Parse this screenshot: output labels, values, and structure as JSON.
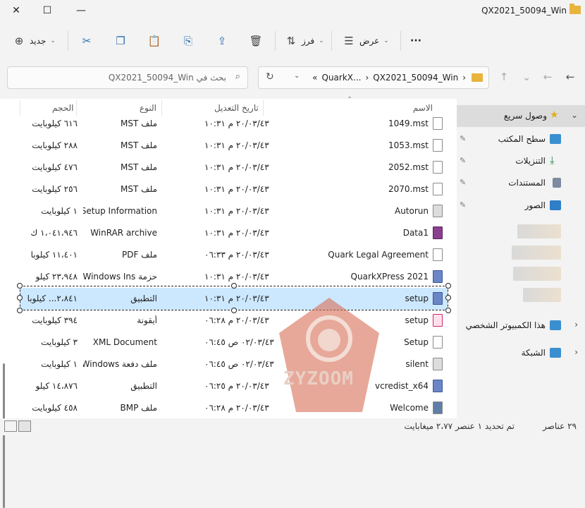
{
  "window": {
    "title": "QX2021_50094_Win",
    "close_glyph": "✕",
    "maximize_glyph": "☐",
    "minimize_glyph": "—"
  },
  "toolbar": {
    "new_label": "جديد",
    "sort_label": "فرز",
    "view_label": "عرض",
    "more_glyph": "···"
  },
  "address": {
    "crumbs": [
      "«",
      "QuarkX...",
      "›",
      "QX2021_50094_Win",
      "›"
    ],
    "search_placeholder": "بحث في QX2021_50094_Win"
  },
  "columns": {
    "name": "الاسم",
    "modified": "تاريخ التعديل",
    "type": "النوع",
    "size": "الحجم"
  },
  "files": [
    {
      "name": "1049.mst",
      "date": "٢٠/٠٣/٤٣ م ١٠:٣١",
      "type": "ملف MST",
      "size": "٦١٦ كيلوبايت",
      "icon": "doc"
    },
    {
      "name": "1053.mst",
      "date": "٢٠/٠٣/٤٣ م ١٠:٣١",
      "type": "ملف MST",
      "size": "٢٨٨ كيلوبايت",
      "icon": "doc"
    },
    {
      "name": "2052.mst",
      "date": "٢٠/٠٣/٤٣ م ١٠:٣١",
      "type": "ملف MST",
      "size": "٤٧٦ كيلوبايت",
      "icon": "doc"
    },
    {
      "name": "2070.mst",
      "date": "٢٠/٠٣/٤٣ م ١٠:٣١",
      "type": "ملف MST",
      "size": "٢٥٦ كيلوبايت",
      "icon": "doc"
    },
    {
      "name": "Autorun",
      "date": "٢٠/٠٣/٤٣ م ١٠:٣١",
      "type": "Setup Information",
      "size": "١ كيلوبايت",
      "icon": "gear"
    },
    {
      "name": "Data1",
      "date": "٢٠/٠٣/٤٣ م ١٠:٣١",
      "type": "WinRAR archive",
      "size": "١،٠٤١،٩٤٦ ك",
      "icon": "rar"
    },
    {
      "name": "Quark Legal Agreement",
      "date": "٢٠/٠٣/٤٣ م ٠٦:٣٣",
      "type": "ملف PDF",
      "size": "١١،٤٠١ كيلوبا",
      "icon": "doc"
    },
    {
      "name": "QuarkXPress 2021",
      "date": "٢٠/٠٣/٤٣ م ١٠:٣١",
      "type": "حزمة Windows Ins...",
      "size": "٢٣،٩٤٨ كيلو",
      "icon": "setup"
    },
    {
      "name": "setup",
      "date": "٢٠/٠٣/٤٣ م ١٠:٣١",
      "type": "التطبيق",
      "size": "٢،٨٤١... كيلوبا",
      "icon": "setup"
    },
    {
      "name": "setup",
      "date": "٢٠/٠٣/٤٣ م ٠٦:٢٨",
      "type": "أيقونة",
      "size": "٣٩٤ كيلوبايت",
      "icon": "pink"
    },
    {
      "name": "Setup",
      "date": "٠٢/٠٣/٤٣ ص ٠٦:٤٥",
      "type": "XML Document",
      "size": "٣ كيلوبايت",
      "icon": "doc"
    },
    {
      "name": "silent",
      "date": "٠٢/٠٣/٤٣ ص ٠٦:٤٥",
      "type": "ملف دفعة Windows",
      "size": "١ كيلوبايت",
      "icon": "gear"
    },
    {
      "name": "vcredist_x64",
      "date": "٢٠/٠٣/٤٣ م ٠٦:٢٥",
      "type": "التطبيق",
      "size": "١٤،٨٧٦ كيلو",
      "icon": "setup"
    },
    {
      "name": "Welcome",
      "date": "٢٠/٠٣/٤٣ م ٠٦:٢٨",
      "type": "ملف BMP",
      "size": "٤٥٨ كيلوبايت",
      "icon": "img"
    }
  ],
  "nav": {
    "quick_access": "وصول سريع",
    "desktop": "سطح المكتب",
    "downloads": "التنزيلات",
    "documents": "المستندات",
    "pictures": "الصور",
    "this_pc": "هذا الكمبيوتر الشخصي",
    "network": "الشبكة"
  },
  "status": {
    "count": "٢٩ عناصر",
    "selection": "تم تحديد ١ عنصر  ٢،٧٧ ميغابايت"
  },
  "watermark": {
    "text": "ZYZOOM"
  },
  "colors": {
    "selection": "#cce8ff",
    "folder": "#e8b43c",
    "watermark": "#d9735a"
  }
}
